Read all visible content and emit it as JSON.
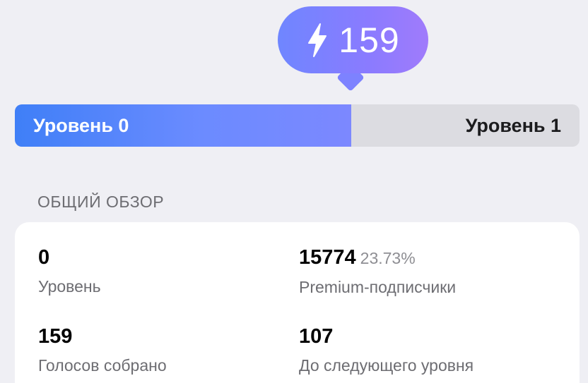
{
  "boost_badge": {
    "icon": "lightning-bolt-icon",
    "count": "159",
    "gradient": [
      "#6f86ff",
      "#a07bfb"
    ]
  },
  "level_bar": {
    "current_label": "Уровень 0",
    "next_label": "Уровень 1",
    "progress_fraction": 0.596,
    "fill_color": "#4a82f8",
    "track_color": "#dcdce1"
  },
  "overview": {
    "title": "ОБЩИЙ ОБЗОР",
    "stats": [
      {
        "value": "0",
        "extra": "",
        "label": "Уровень"
      },
      {
        "value": "15774",
        "extra": "23.73%",
        "label": "Premium-подписчики"
      },
      {
        "value": "159",
        "extra": "",
        "label": "Голосов собрано"
      },
      {
        "value": "107",
        "extra": "",
        "label": "До следующего уровня"
      }
    ]
  }
}
